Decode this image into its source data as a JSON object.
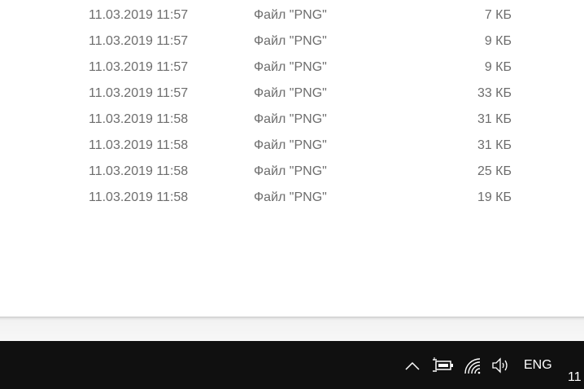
{
  "files": [
    {
      "date": "11.03.2019 11:57",
      "type": "Файл \"PNG\"",
      "size": "7 КБ"
    },
    {
      "date": "11.03.2019 11:57",
      "type": "Файл \"PNG\"",
      "size": "9 КБ"
    },
    {
      "date": "11.03.2019 11:57",
      "type": "Файл \"PNG\"",
      "size": "9 КБ"
    },
    {
      "date": "11.03.2019 11:57",
      "type": "Файл \"PNG\"",
      "size": "33 КБ"
    },
    {
      "date": "11.03.2019 11:58",
      "type": "Файл \"PNG\"",
      "size": "31 КБ"
    },
    {
      "date": "11.03.2019 11:58",
      "type": "Файл \"PNG\"",
      "size": "31 КБ"
    },
    {
      "date": "11.03.2019 11:58",
      "type": "Файл \"PNG\"",
      "size": "25 КБ"
    },
    {
      "date": "11.03.2019 11:58",
      "type": "Файл \"PNG\"",
      "size": "19 КБ"
    }
  ],
  "taskbar": {
    "language": "ENG",
    "clock_partial": "11",
    "icons": [
      "chevron-up-icon",
      "battery-charging-icon",
      "wifi-icon",
      "speaker-icon"
    ],
    "colors": {
      "background": "#101010",
      "text": "#ffffff",
      "file_text": "#6d6d6d"
    }
  }
}
